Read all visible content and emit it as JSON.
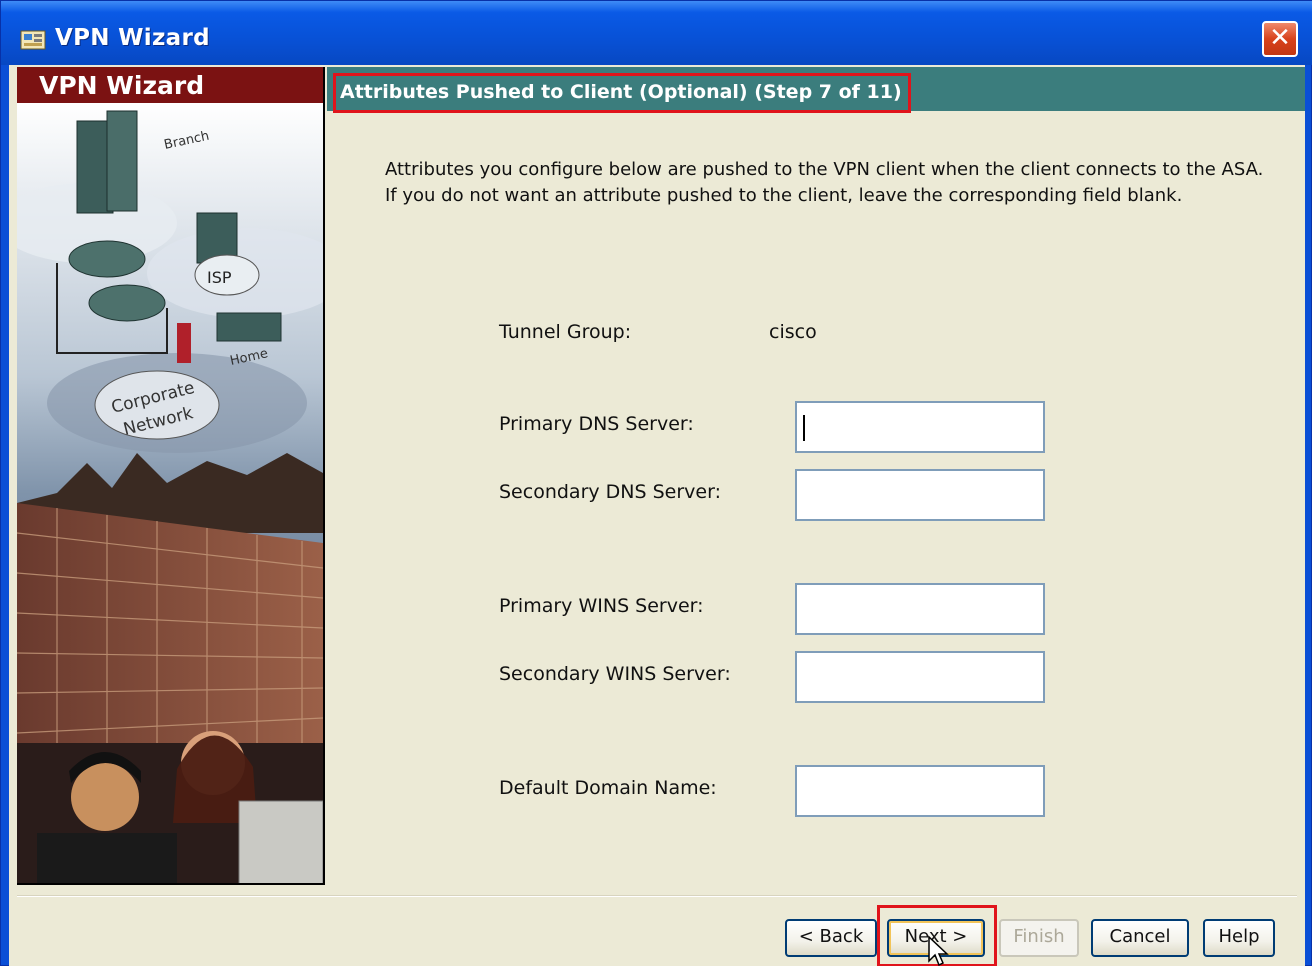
{
  "window": {
    "title": "VPN Wizard"
  },
  "side_panel": {
    "header": "VPN Wizard",
    "art_labels": {
      "branch": "Branch",
      "isp": "ISP",
      "home": "Home",
      "corporate": "Corporate",
      "network": "Network"
    }
  },
  "step": {
    "title": "Attributes Pushed to Client (Optional)  (Step 7 of 11)"
  },
  "description": "Attributes you configure below are pushed to the VPN client when the client connects to the ASA. If you do not want an attribute pushed to the client, leave the corresponding field blank.",
  "form": {
    "tunnel_group_label": "Tunnel Group:",
    "tunnel_group_value": "cisco",
    "primary_dns_label": "Primary DNS Server:",
    "primary_dns_value": "",
    "secondary_dns_label": "Secondary DNS Server:",
    "secondary_dns_value": "",
    "primary_wins_label": "Primary WINS Server:",
    "primary_wins_value": "",
    "secondary_wins_label": "Secondary WINS Server:",
    "secondary_wins_value": "",
    "domain_label": "Default Domain Name:",
    "domain_value": ""
  },
  "buttons": {
    "back": "< Back",
    "next": "Next >",
    "finish": "Finish",
    "cancel": "Cancel",
    "help": "Help"
  },
  "colors": {
    "title_bar": "#0851d6",
    "side_header": "#7b1212",
    "step_banner": "#3b7d7d",
    "highlight": "#e0141b",
    "client_bg": "#ecead6"
  }
}
